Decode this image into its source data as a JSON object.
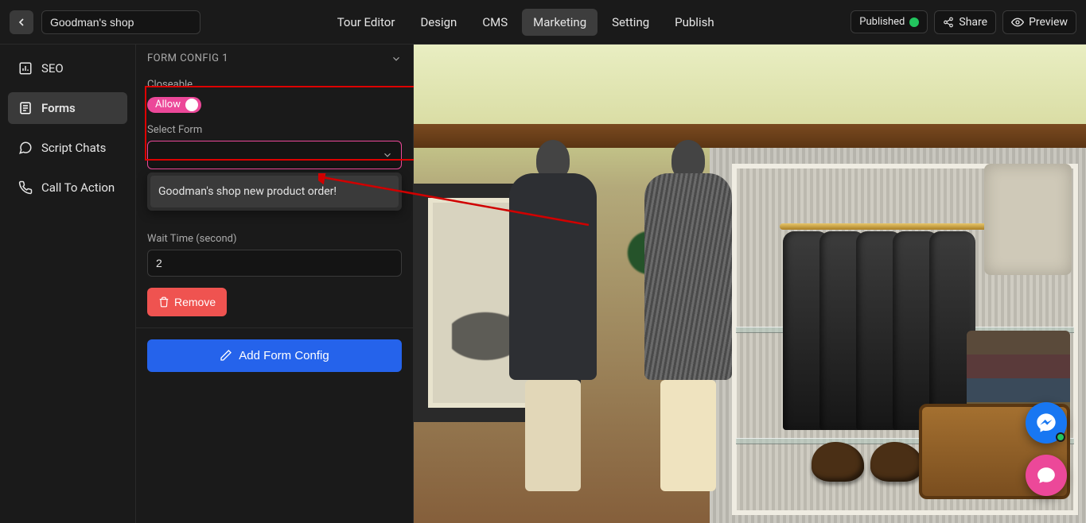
{
  "header": {
    "project_title": "Goodman's shop",
    "nav": [
      "Tour Editor",
      "Design",
      "CMS",
      "Marketing",
      "Setting",
      "Publish"
    ],
    "nav_active_index": 3,
    "status": "Published",
    "share_label": "Share",
    "preview_label": "Preview"
  },
  "sidebar": {
    "items": [
      {
        "label": "SEO",
        "icon": "chart-icon"
      },
      {
        "label": "Forms",
        "icon": "form-icon"
      },
      {
        "label": "Script Chats",
        "icon": "chat-icon"
      },
      {
        "label": "Call To Action",
        "icon": "phone-icon"
      }
    ],
    "active_index": 1
  },
  "panel": {
    "title": "FORM CONFIG 1",
    "closeable_label": "Closeable",
    "allow_label": "Allow",
    "select_form_label": "Select Form",
    "select_form_value": "",
    "dropdown_options": [
      "Goodman's shop new product order!"
    ],
    "wait_time_label": "Wait Time (second)",
    "wait_time_value": "2",
    "remove_label": "Remove",
    "add_label": "Add Form Config"
  },
  "colors": {
    "accent_pink": "#ec4899",
    "primary_blue": "#2563eb",
    "danger": "#ef5350",
    "success": "#22c55e",
    "annotation_red": "#d00000"
  }
}
